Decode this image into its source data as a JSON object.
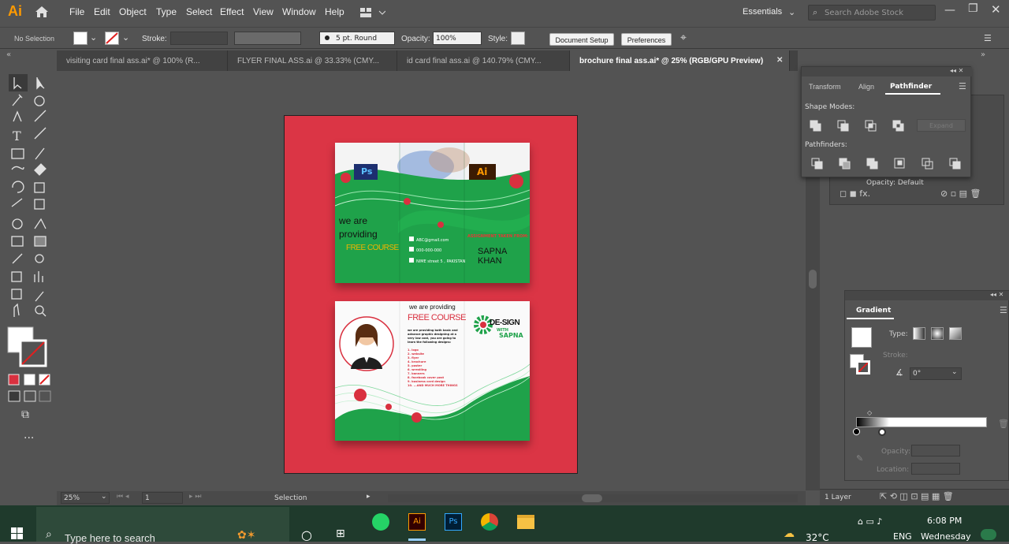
{
  "app": {
    "logo": "Ai",
    "menu": [
      "File",
      "Edit",
      "Object",
      "Type",
      "Select",
      "Effect",
      "View",
      "Window",
      "Help"
    ],
    "workspace": "Essentials",
    "search_placeholder": "Search Adobe Stock"
  },
  "control": {
    "selection": "No Selection",
    "stroke_label": "Stroke:",
    "brush": "5 pt. Round",
    "opacity_label": "Opacity:",
    "opacity": "100%",
    "style_label": "Style:",
    "doc_setup": "Document Setup",
    "preferences": "Preferences"
  },
  "tabs": [
    "visiting card final ass.ai* @ 100% (R...",
    "FLYER FINAL ASS.ai @ 33.33% (CMY...",
    "id card final ass.ai @ 140.79% (CMY...",
    "brochure final ass.ai* @ 25% (RGB/GPU Preview)"
  ],
  "pathfinder": {
    "tabs": [
      "Transform",
      "Align",
      "Pathfinder"
    ],
    "shape_modes": "Shape Modes:",
    "expand": "Expand",
    "pathfinders": "Pathfinders:",
    "opacity_row": "Opacity: Default"
  },
  "gradient": {
    "title": "Gradient",
    "type": "Type:",
    "stroke": "Stroke:",
    "angle": "0°",
    "opacity": "Opacity:",
    "location": "Location:"
  },
  "layers": {
    "count": "1 Layer"
  },
  "status": {
    "zoom": "25%",
    "page": "1",
    "tool": "Selection"
  },
  "brochure": {
    "front": {
      "line1": "we are",
      "line2": "providing",
      "line3": "FREE COURSE",
      "email": "ABC@gmail.com",
      "phone": "000-000-000",
      "address": "NIME street 5 , PAKISTAN",
      "name_small": "ASSIGNMENT TAKEN FROM:",
      "name": "SAPNA KHAN",
      "ps": "Ps",
      "ai": "Ai"
    },
    "back": {
      "heading": "we are providing",
      "course": "FREE COURSE",
      "desc": "we are providing both basic and advance graphic designing at a very low cost, you are going to learn the following designs:",
      "list": [
        "1. logo",
        "2. website",
        "3. flyer",
        "4. brochure",
        "5. poster",
        "6. wrestling",
        "7. banners",
        "8. facebook cover post",
        "9. business card design",
        "10. ...AND MUCH MORE THINGS"
      ],
      "brand1": "DE-SIGN",
      "brand2": "WITH",
      "brand3": "SAPNA"
    }
  },
  "taskbar": {
    "search": "Type here to search",
    "weather": "32°C",
    "lang": "ENG",
    "time": "6:08 PM",
    "day": "Wednesday"
  }
}
